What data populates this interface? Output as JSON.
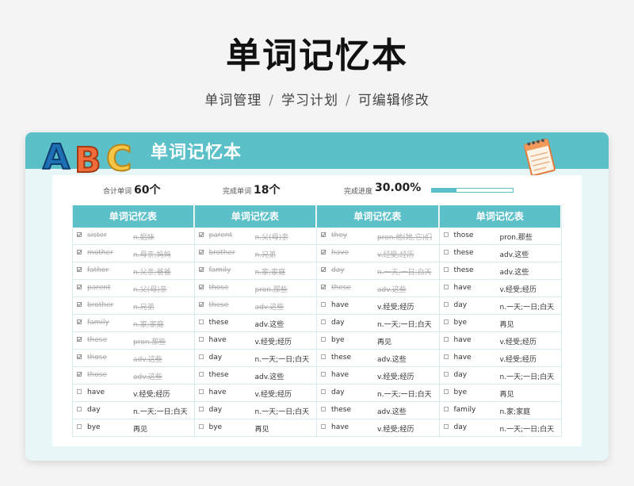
{
  "header": {
    "title": "单词记忆本",
    "subtitle_items": [
      "单词管理",
      "学习计划",
      "可编辑修改"
    ],
    "separator": "/"
  },
  "card": {
    "banner_title": "单词记忆本",
    "logo_letters": [
      "A",
      "B",
      "C"
    ],
    "logo_icon": "abc-letters",
    "notebook_icon": "notebook-icon",
    "accent_color": "#5cc0c9"
  },
  "stats": {
    "total_label": "合计单词",
    "total_value": "60个",
    "done_label": "完成单词",
    "done_value": "18个",
    "progress_label": "完成进度",
    "progress_value": "30.00%",
    "progress_fraction": 0.3
  },
  "table": {
    "columns": [
      {
        "header": "单词记忆表",
        "rows": [
          {
            "word": "sister",
            "meaning": "n.姐妹",
            "done": true
          },
          {
            "word": "mother",
            "meaning": "n.母亲;妈妈",
            "done": true
          },
          {
            "word": "father",
            "meaning": "n.父亲;爸爸",
            "done": true
          },
          {
            "word": "parent",
            "meaning": "n.父(母)亲",
            "done": true
          },
          {
            "word": "brother",
            "meaning": "n.兄弟",
            "done": true
          },
          {
            "word": "family",
            "meaning": "n.家;家庭",
            "done": true
          },
          {
            "word": "these",
            "meaning": "pron.那些",
            "done": true
          },
          {
            "word": "those",
            "meaning": "adv.这些",
            "done": true
          },
          {
            "word": "those",
            "meaning": "adv.这些",
            "done": true
          },
          {
            "word": "have",
            "meaning": "v.经受;经历",
            "done": false
          },
          {
            "word": "day",
            "meaning": "n.一天;一日;白天",
            "done": false
          },
          {
            "word": "bye",
            "meaning": "再见",
            "done": false
          }
        ]
      },
      {
        "header": "单词记忆表",
        "rows": [
          {
            "word": "parent",
            "meaning": "n.父(母)亲",
            "done": true
          },
          {
            "word": "brother",
            "meaning": "n.兄弟",
            "done": true
          },
          {
            "word": "family",
            "meaning": "n.家;家庭",
            "done": true
          },
          {
            "word": "those",
            "meaning": "pron.那些",
            "done": true
          },
          {
            "word": "these",
            "meaning": "adv.这些",
            "done": true
          },
          {
            "word": "these",
            "meaning": "adv.这些",
            "done": false
          },
          {
            "word": "have",
            "meaning": "v.经受;经历",
            "done": false
          },
          {
            "word": "day",
            "meaning": "n.一天;一日;白天",
            "done": false
          },
          {
            "word": "these",
            "meaning": "adv.这些",
            "done": false
          },
          {
            "word": "have",
            "meaning": "v.经受;经历",
            "done": false
          },
          {
            "word": "day",
            "meaning": "n.一天;一日;白天",
            "done": false
          },
          {
            "word": "bye",
            "meaning": "再见",
            "done": false
          }
        ]
      },
      {
        "header": "单词记忆表",
        "rows": [
          {
            "word": "they",
            "meaning": "pron.他(她,它)们",
            "done": true
          },
          {
            "word": "have",
            "meaning": "v.经受;经历",
            "done": true
          },
          {
            "word": "day",
            "meaning": "n.一天;一日;白天",
            "done": true
          },
          {
            "word": "these",
            "meaning": "adv.这些",
            "done": true
          },
          {
            "word": "have",
            "meaning": "v.经受;经历",
            "done": false
          },
          {
            "word": "day",
            "meaning": "n.一天;一日;白天",
            "done": false
          },
          {
            "word": "bye",
            "meaning": "再见",
            "done": false
          },
          {
            "word": "these",
            "meaning": "adv.这些",
            "done": false
          },
          {
            "word": "have",
            "meaning": "v.经受;经历",
            "done": false
          },
          {
            "word": "day",
            "meaning": "n.一天;一日;白天",
            "done": false
          },
          {
            "word": "these",
            "meaning": "adv.这些",
            "done": false
          },
          {
            "word": "have",
            "meaning": "v.经受;经历",
            "done": false
          }
        ]
      },
      {
        "header": "单词记忆表",
        "rows": [
          {
            "word": "those",
            "meaning": "pron.那些",
            "done": false
          },
          {
            "word": "these",
            "meaning": "adv.这些",
            "done": false
          },
          {
            "word": "these",
            "meaning": "adv.这些",
            "done": false
          },
          {
            "word": "have",
            "meaning": "v.经受;经历",
            "done": false
          },
          {
            "word": "day",
            "meaning": "n.一天;一日;白天",
            "done": false
          },
          {
            "word": "bye",
            "meaning": "再见",
            "done": false
          },
          {
            "word": "have",
            "meaning": "v.经受;经历",
            "done": false
          },
          {
            "word": "have",
            "meaning": "v.经受;经历",
            "done": false
          },
          {
            "word": "day",
            "meaning": "n.一天;一日;白天",
            "done": false
          },
          {
            "word": "bye",
            "meaning": "再见",
            "done": false
          },
          {
            "word": "family",
            "meaning": "n.家;家庭",
            "done": false
          },
          {
            "word": "day",
            "meaning": "n.一天;一日;白天",
            "done": false
          }
        ]
      }
    ]
  }
}
